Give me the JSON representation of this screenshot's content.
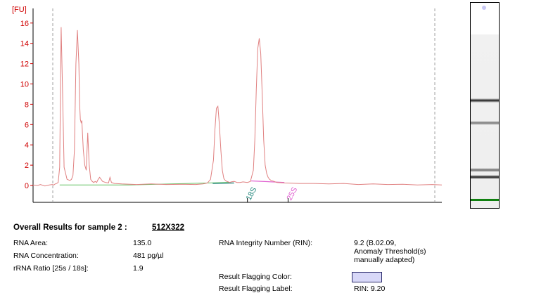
{
  "chart_data": {
    "type": "line",
    "title": "",
    "xlabel": "",
    "ylabel": "[FU]",
    "ylim": [
      -1.5,
      17
    ],
    "yticks": [
      0,
      2,
      4,
      6,
      8,
      10,
      12,
      14,
      16
    ],
    "grid": false,
    "line_color": "#e08080",
    "axis_label_color": "#d00000",
    "series": [
      {
        "x": [
          0,
          6,
          10,
          16,
          22,
          26,
          28,
          30,
          32,
          34,
          36,
          38,
          40,
          42,
          46,
          50,
          52,
          54,
          56,
          58,
          60,
          62,
          63,
          64,
          65,
          66,
          68,
          70,
          72,
          74,
          76,
          78,
          80,
          82,
          84,
          86,
          88,
          90,
          94,
          98,
          102,
          104,
          106,
          110,
          120,
          140,
          160,
          180,
          200,
          220,
          230,
          236,
          240,
          244,
          246,
          248,
          250,
          252,
          254,
          256,
          258,
          260,
          262,
          264,
          266,
          268,
          272,
          276,
          280,
          284,
          290,
          294,
          298,
          300,
          302,
          304,
          306,
          308,
          310,
          312,
          314,
          316,
          318,
          320,
          322,
          326,
          330,
          340,
          360,
          380,
          400,
          420,
          440,
          460,
          480,
          500,
          520,
          540,
          553
        ],
        "y": [
          0.05,
          0.0,
          0.1,
          -0.05,
          0.05,
          0.1,
          0.05,
          0.15,
          0.2,
          0.3,
          1.8,
          15.6,
          9.0,
          1.8,
          0.6,
          0.5,
          0.6,
          1.0,
          3.5,
          12.0,
          15.3,
          12.0,
          8.0,
          6.5,
          6.2,
          6.4,
          3.5,
          2.0,
          1.5,
          5.2,
          2.0,
          0.6,
          0.4,
          0.3,
          0.4,
          0.3,
          0.6,
          0.8,
          0.4,
          0.3,
          0.25,
          0.8,
          0.3,
          0.2,
          0.15,
          0.1,
          0.15,
          0.1,
          0.12,
          0.1,
          0.15,
          0.25,
          0.6,
          2.5,
          5.5,
          7.6,
          7.8,
          6.0,
          3.5,
          1.5,
          0.7,
          0.5,
          0.4,
          0.35,
          0.3,
          0.35,
          0.4,
          0.3,
          0.3,
          0.35,
          0.3,
          0.4,
          1.5,
          4.5,
          9.5,
          13.5,
          14.5,
          13.0,
          9.0,
          4.5,
          2.0,
          1.2,
          0.8,
          0.6,
          0.5,
          0.4,
          0.3,
          0.25,
          0.2,
          0.2,
          0.15,
          0.2,
          0.1,
          0.15,
          0.1,
          0.12,
          0.05,
          0.1,
          0.05
        ]
      }
    ],
    "markers": [
      {
        "label": "18S",
        "x": 290,
        "color": "#2a8a80"
      },
      {
        "label": "25S",
        "x": 345,
        "color": "#e060d0"
      }
    ]
  },
  "results": {
    "heading": "Overall Results for sample 2  :",
    "sample_name": "512X322",
    "rna_area_label": "RNA Area:",
    "rna_area_value": "135.0",
    "rna_concentration_label": "RNA Concentration:",
    "rna_concentration_value": "481 pg/µl",
    "rrna_ratio_label": "rRNA Ratio [25s / 18s]:",
    "rrna_ratio_value": "1.9",
    "rin_label": "RNA Integrity Number (RIN):",
    "rin_value_line1": "9.2  (B.02.09,",
    "rin_value_line2": "Anomaly Threshold(s)",
    "rin_value_line3": "manually adapted)",
    "flag_color_label": "Result Flagging Color:",
    "flag_color": "#d8d8f8",
    "flag_label_label": "Result Flagging Label:",
    "flag_label_value": "RIN: 9.20"
  },
  "gel": {
    "bands": [
      {
        "position": 0.38,
        "intensity": 1.0
      },
      {
        "position": 0.51,
        "intensity": 0.6
      },
      {
        "position": 0.78,
        "intensity": 0.65
      },
      {
        "position": 0.82,
        "intensity": 1.0
      }
    ],
    "marker_band": {
      "position": 0.95,
      "color": "#108010"
    },
    "well_color": "#c8c8f4"
  }
}
